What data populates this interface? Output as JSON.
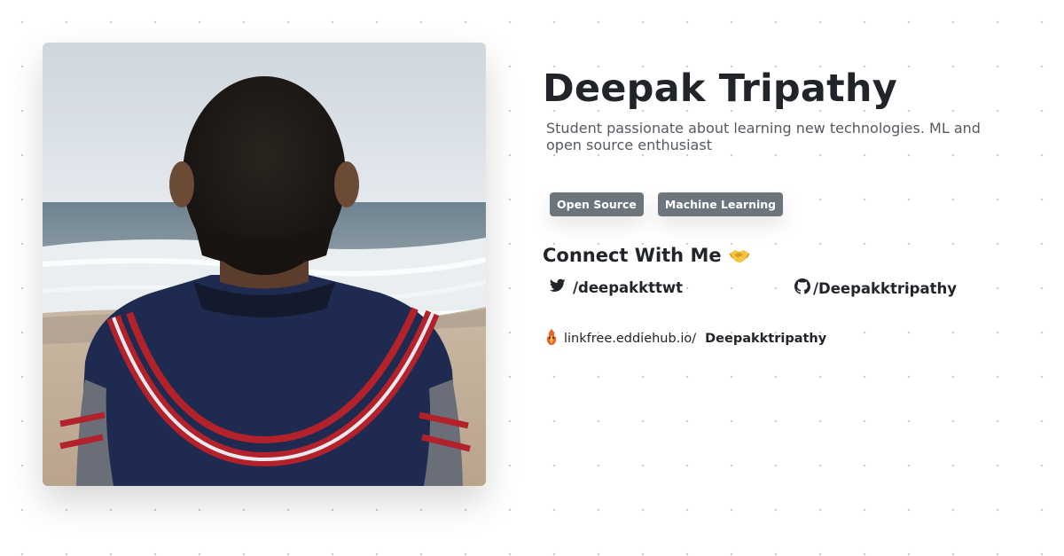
{
  "profile": {
    "name": "Deepak Tripathy",
    "bio": "Student passionate about learning new technologies. ML and open source enthusiast",
    "photo_alt": "Profile photo"
  },
  "tags": [
    "Open Source",
    "Machine Learning"
  ],
  "connect": {
    "title": "Connect With Me",
    "title_icon": "handshake-icon",
    "twitter": {
      "icon": "twitter-icon",
      "label": "/deepakkttwt"
    },
    "github": {
      "icon": "github-icon",
      "label": "/Deepakktripathy"
    }
  },
  "linkfree": {
    "icon": "linkfree-logo-icon",
    "prefix": "linkfree.eddiehub.io/",
    "username": "Deepakktripathy"
  },
  "colors": {
    "tag_background": "#6c757d",
    "text_primary": "#212529",
    "text_secondary": "#555b61"
  }
}
